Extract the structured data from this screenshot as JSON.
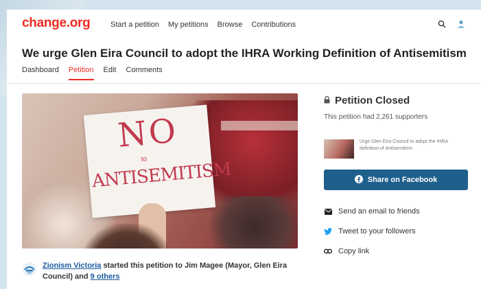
{
  "header": {
    "logo": "change.org",
    "nav": [
      "Start a petition",
      "My petitions",
      "Browse",
      "Contributions"
    ],
    "icons": [
      "search-icon",
      "avatar-icon"
    ]
  },
  "petition": {
    "title": "We urge Glen Eira Council to adopt the IHRA Working Definition of Antisemitism",
    "tabs": [
      {
        "label": "Dashboard",
        "active": false
      },
      {
        "label": "Petition",
        "active": true
      },
      {
        "label": "Edit",
        "active": false
      },
      {
        "label": "Comments",
        "active": false
      }
    ],
    "sign_text": {
      "line1": "NO",
      "line2": "to",
      "line3": "ANTISEMITISM"
    },
    "starter": {
      "author": "Zionism Victoria",
      "middle": "started this petition to Jim Magee (Mayor, Glen Eira Council) and",
      "others": "9 others"
    }
  },
  "sidebar": {
    "status": "Petition Closed",
    "supporters_text": "This petition had 2,261 supporters",
    "mini_card_text": "Urge Glen Eira Council to adopt the IHRA definition of Antisemitism",
    "facebook_label": "Share on Facebook",
    "email_label": "Send an email to friends",
    "tweet_label": "Tweet to your followers",
    "copy_label": "Copy link"
  },
  "colors": {
    "brand": "#ec2c22",
    "facebook": "#1f5f8b",
    "twitter": "#1da1f2",
    "link": "#1c5b9c"
  }
}
